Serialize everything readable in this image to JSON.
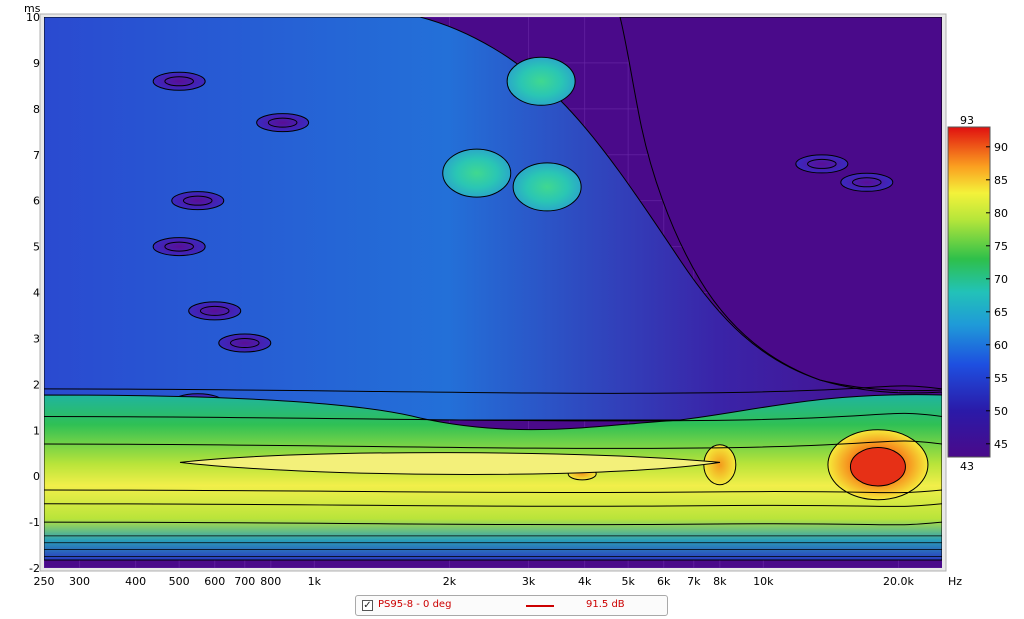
{
  "chart_data": {
    "type": "heatmap",
    "title": "",
    "xlabel": "Hz",
    "ylabel": "ms",
    "x_scale": "log",
    "xlim": [
      250,
      25000
    ],
    "ylim": [
      -2,
      10
    ],
    "x_ticks": [
      {
        "value": 250,
        "label": "250"
      },
      {
        "value": 300,
        "label": "300"
      },
      {
        "value": 400,
        "label": "400"
      },
      {
        "value": 500,
        "label": "500"
      },
      {
        "value": 600,
        "label": "600"
      },
      {
        "value": 700,
        "label": "700"
      },
      {
        "value": 800,
        "label": "800"
      },
      {
        "value": 1000,
        "label": "1k"
      },
      {
        "value": 2000,
        "label": "2k"
      },
      {
        "value": 3000,
        "label": "3k"
      },
      {
        "value": 4000,
        "label": "4k"
      },
      {
        "value": 5000,
        "label": "5k"
      },
      {
        "value": 6000,
        "label": "6k"
      },
      {
        "value": 7000,
        "label": "7k"
      },
      {
        "value": 8000,
        "label": "8k"
      },
      {
        "value": 10000,
        "label": "10k"
      },
      {
        "value": 20000,
        "label": "20.0k"
      }
    ],
    "y_ticks": [
      {
        "value": -2,
        "label": "-2"
      },
      {
        "value": -1,
        "label": "-1"
      },
      {
        "value": 0,
        "label": "0"
      },
      {
        "value": 1,
        "label": "1"
      },
      {
        "value": 2,
        "label": "2"
      },
      {
        "value": 3,
        "label": "3"
      },
      {
        "value": 4,
        "label": "4"
      },
      {
        "value": 5,
        "label": "5"
      },
      {
        "value": 6,
        "label": "6"
      },
      {
        "value": 7,
        "label": "7"
      },
      {
        "value": 8,
        "label": "8"
      },
      {
        "value": 9,
        "label": "9"
      },
      {
        "value": 10,
        "label": "10"
      }
    ],
    "colorbar": {
      "min": 43,
      "max": 93,
      "min_label": "43",
      "max_label": "93",
      "ticks": [
        {
          "value": 90,
          "label": "90"
        },
        {
          "value": 85,
          "label": "85"
        },
        {
          "value": 80,
          "label": "80"
        },
        {
          "value": 75,
          "label": "75"
        },
        {
          "value": 70,
          "label": "70"
        },
        {
          "value": 65,
          "label": "65"
        },
        {
          "value": 60,
          "label": "60"
        },
        {
          "value": 55,
          "label": "55"
        },
        {
          "value": 50,
          "label": "50"
        },
        {
          "value": 45,
          "label": "45"
        }
      ]
    },
    "colors": {
      "background": "#4a0a8a",
      "grid": "#6a2aa8",
      "contour": "#000000",
      "ridge": "#f3f07a",
      "series": "#cc0000"
    },
    "bands": [
      {
        "t_top": 1.9,
        "t_bottom": -1.0,
        "level": 72
      },
      {
        "t_top": 1.3,
        "t_bottom": -0.6,
        "level": 78
      },
      {
        "t_top": 0.7,
        "t_bottom": -0.3,
        "level": 83
      }
    ],
    "hotspots": [
      {
        "freq": 8000,
        "time": 0.25,
        "level": 87
      },
      {
        "freq": 18000,
        "time": 0.25,
        "level": 91
      },
      {
        "freq": 3950,
        "time": 0.05,
        "level": 85
      }
    ],
    "islands": [
      {
        "freq": 2300,
        "time": 6.6,
        "level": 68
      },
      {
        "freq": 3300,
        "time": 6.3,
        "level": 67
      },
      {
        "freq": 3200,
        "time": 8.6,
        "level": 63
      },
      {
        "freq": 550,
        "time": 1.6,
        "level": 46
      },
      {
        "freq": 500,
        "time": 8.6,
        "level": 47
      },
      {
        "freq": 550,
        "time": 6.0,
        "level": 47
      },
      {
        "freq": 500,
        "time": 5.0,
        "level": 47
      },
      {
        "freq": 600,
        "time": 3.6,
        "level": 47
      },
      {
        "freq": 700,
        "time": 2.9,
        "level": 47
      },
      {
        "freq": 850,
        "time": 7.7,
        "level": 47
      },
      {
        "freq": 17000,
        "time": 6.4,
        "level": 50
      },
      {
        "freq": 13500,
        "time": 6.8,
        "level": 50
      }
    ]
  },
  "legend": {
    "checked_symbol": "✓",
    "series_name": "PS95-8 - 0 deg",
    "series_value": "91.5 dB"
  }
}
